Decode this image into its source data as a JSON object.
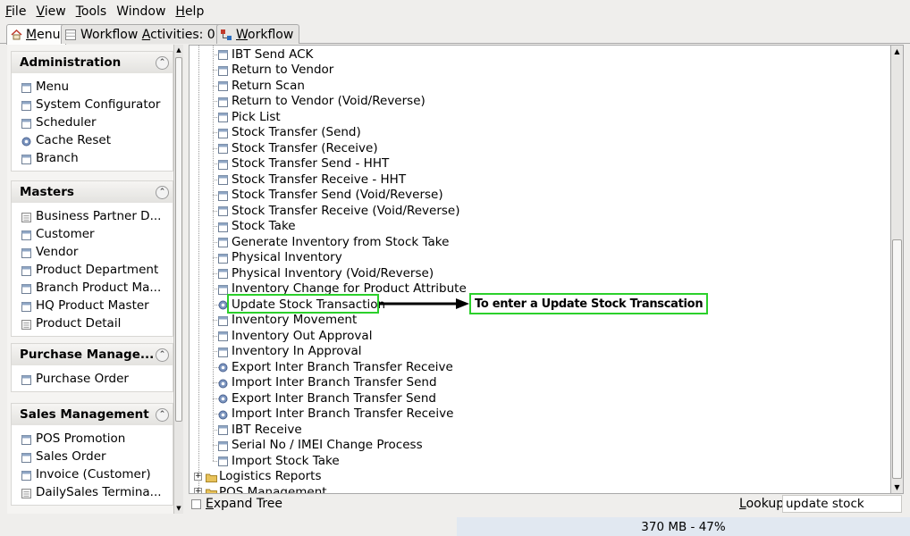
{
  "menubar": {
    "items": [
      {
        "ul": "F",
        "rest": "ile"
      },
      {
        "ul": "V",
        "rest": "iew"
      },
      {
        "ul": "T",
        "rest": "ools"
      },
      {
        "ul": "",
        "rest": "Window"
      },
      {
        "ul": "H",
        "rest": "elp"
      }
    ]
  },
  "tabs": {
    "menu": {
      "ul": "M",
      "rest": "enu",
      "icon": "home-icon"
    },
    "workflow_activities": {
      "pre": "Workflow ",
      "ul": "A",
      "rest": "ctivities: 0",
      "icon": "table-icon"
    },
    "workflow": {
      "ul": "W",
      "rest": "orkflow",
      "icon": "workflow-icon"
    }
  },
  "sidebar": {
    "panels": [
      {
        "title": "Administration",
        "items": [
          "Menu",
          "System Configurator",
          "Scheduler",
          "Cache Reset",
          "Branch"
        ],
        "icons": [
          "window",
          "window",
          "window",
          "gear",
          "window"
        ]
      },
      {
        "title": "Masters",
        "items": [
          "Business Partner D...",
          "Customer",
          "Vendor",
          "Product Department",
          "Branch Product Ma...",
          "HQ Product Master",
          "Product Detail"
        ],
        "icons": [
          "doc",
          "window",
          "window",
          "window",
          "window",
          "window",
          "doc"
        ]
      },
      {
        "title": "Purchase Manage...",
        "items": [
          "Purchase Order"
        ],
        "icons": [
          "window"
        ]
      },
      {
        "title": "Sales Management",
        "items": [
          "POS Promotion",
          "Sales Order",
          "Invoice (Customer)",
          "DailySales Termina..."
        ],
        "icons": [
          "window",
          "window",
          "window",
          "doc"
        ]
      }
    ]
  },
  "tree": {
    "items": [
      {
        "label": "IBT Send ACK",
        "icon": "window"
      },
      {
        "label": "Return to Vendor",
        "icon": "window"
      },
      {
        "label": "Return Scan",
        "icon": "window"
      },
      {
        "label": "Return to Vendor (Void/Reverse)",
        "icon": "window"
      },
      {
        "label": "Pick List",
        "icon": "window"
      },
      {
        "label": "Stock Transfer (Send)",
        "icon": "window"
      },
      {
        "label": "Stock Transfer (Receive)",
        "icon": "window"
      },
      {
        "label": "Stock Transfer Send - HHT",
        "icon": "window"
      },
      {
        "label": "Stock Transfer Receive - HHT",
        "icon": "window"
      },
      {
        "label": "Stock Transfer Send (Void/Reverse)",
        "icon": "window"
      },
      {
        "label": "Stock Transfer Receive (Void/Reverse)",
        "icon": "window"
      },
      {
        "label": "Stock Take",
        "icon": "window"
      },
      {
        "label": "Generate Inventory from Stock Take",
        "icon": "window"
      },
      {
        "label": "Physical Inventory",
        "icon": "window"
      },
      {
        "label": "Physical Inventory (Void/Reverse)",
        "icon": "window"
      },
      {
        "label": "Inventory Change for Product Attribute",
        "icon": "window"
      },
      {
        "label": "Update Stock Transaction",
        "icon": "gear"
      },
      {
        "label": "Inventory Movement",
        "icon": "window"
      },
      {
        "label": "Inventory Out Approval",
        "icon": "window"
      },
      {
        "label": "Inventory In Approval",
        "icon": "window"
      },
      {
        "label": "Export Inter Branch Transfer Receive",
        "icon": "gear"
      },
      {
        "label": "Import Inter Branch Transfer Send",
        "icon": "gear"
      },
      {
        "label": "Export Inter Branch Transfer Send",
        "icon": "gear"
      },
      {
        "label": "Import Inter Branch Transfer Receive",
        "icon": "gear"
      },
      {
        "label": "IBT Receive",
        "icon": "window"
      },
      {
        "label": "Serial No / IMEI Change Process",
        "icon": "window"
      },
      {
        "label": "Import Stock Take",
        "icon": "window"
      }
    ],
    "folders": [
      {
        "label": "Logistics Reports"
      },
      {
        "label": "POS Management"
      }
    ]
  },
  "callout": {
    "text": "To enter a Update Stock Transcation"
  },
  "bottom": {
    "expand_tree": {
      "ul": "E",
      "rest": "xpand Tree"
    },
    "lookup": {
      "ul": "L",
      "rest": "ookup"
    },
    "lookup_value": "update stock"
  },
  "status": {
    "memory": "370 MB - 47%"
  },
  "colors": {
    "highlight": "#2bd02b",
    "status_bar_bg": "#e1e8f1"
  }
}
